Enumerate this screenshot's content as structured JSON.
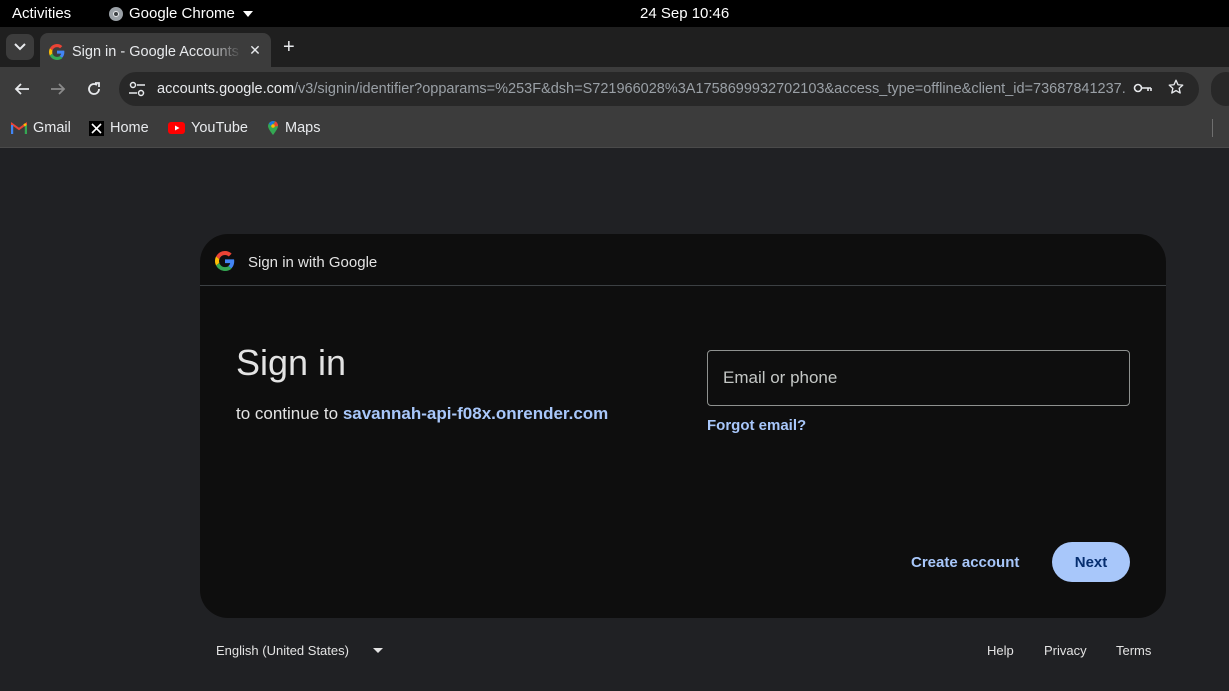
{
  "system_bar": {
    "activities": "Activities",
    "app_name": "Google Chrome",
    "clock": "24 Sep  10:46"
  },
  "tab": {
    "title": "Sign in - Google Accounts",
    "close_glyph": "✕"
  },
  "new_tab_glyph": "+",
  "toolbar": {
    "url_host": "accounts.google.com",
    "url_path": "/v3/signin/identifier?opparams=%253F&dsh=S721966028%3A1758699932702103&access_type=offline&client_id=73687841237..."
  },
  "bookmarks": [
    {
      "label": "Gmail",
      "icon": "gmail-icon"
    },
    {
      "label": "Home",
      "icon": "x-icon"
    },
    {
      "label": "YouTube",
      "icon": "youtube-icon"
    },
    {
      "label": "Maps",
      "icon": "maps-icon"
    }
  ],
  "signin": {
    "header_label": "Sign in with Google",
    "heading": "Sign in",
    "subtitle_prefix": "to continue to ",
    "subtitle_link": "savannah-api-f08x.onrender.com",
    "email_placeholder": "Email or phone",
    "forgot_email": "Forgot email?",
    "create_account": "Create account",
    "next": "Next"
  },
  "footer": {
    "language": "English (United States)",
    "help": "Help",
    "privacy": "Privacy",
    "terms": "Terms"
  },
  "colors": {
    "page_bg": "#202124",
    "card_bg": "#0e0e0e",
    "accent": "#a8c7fa",
    "button_text": "#062e6f"
  }
}
